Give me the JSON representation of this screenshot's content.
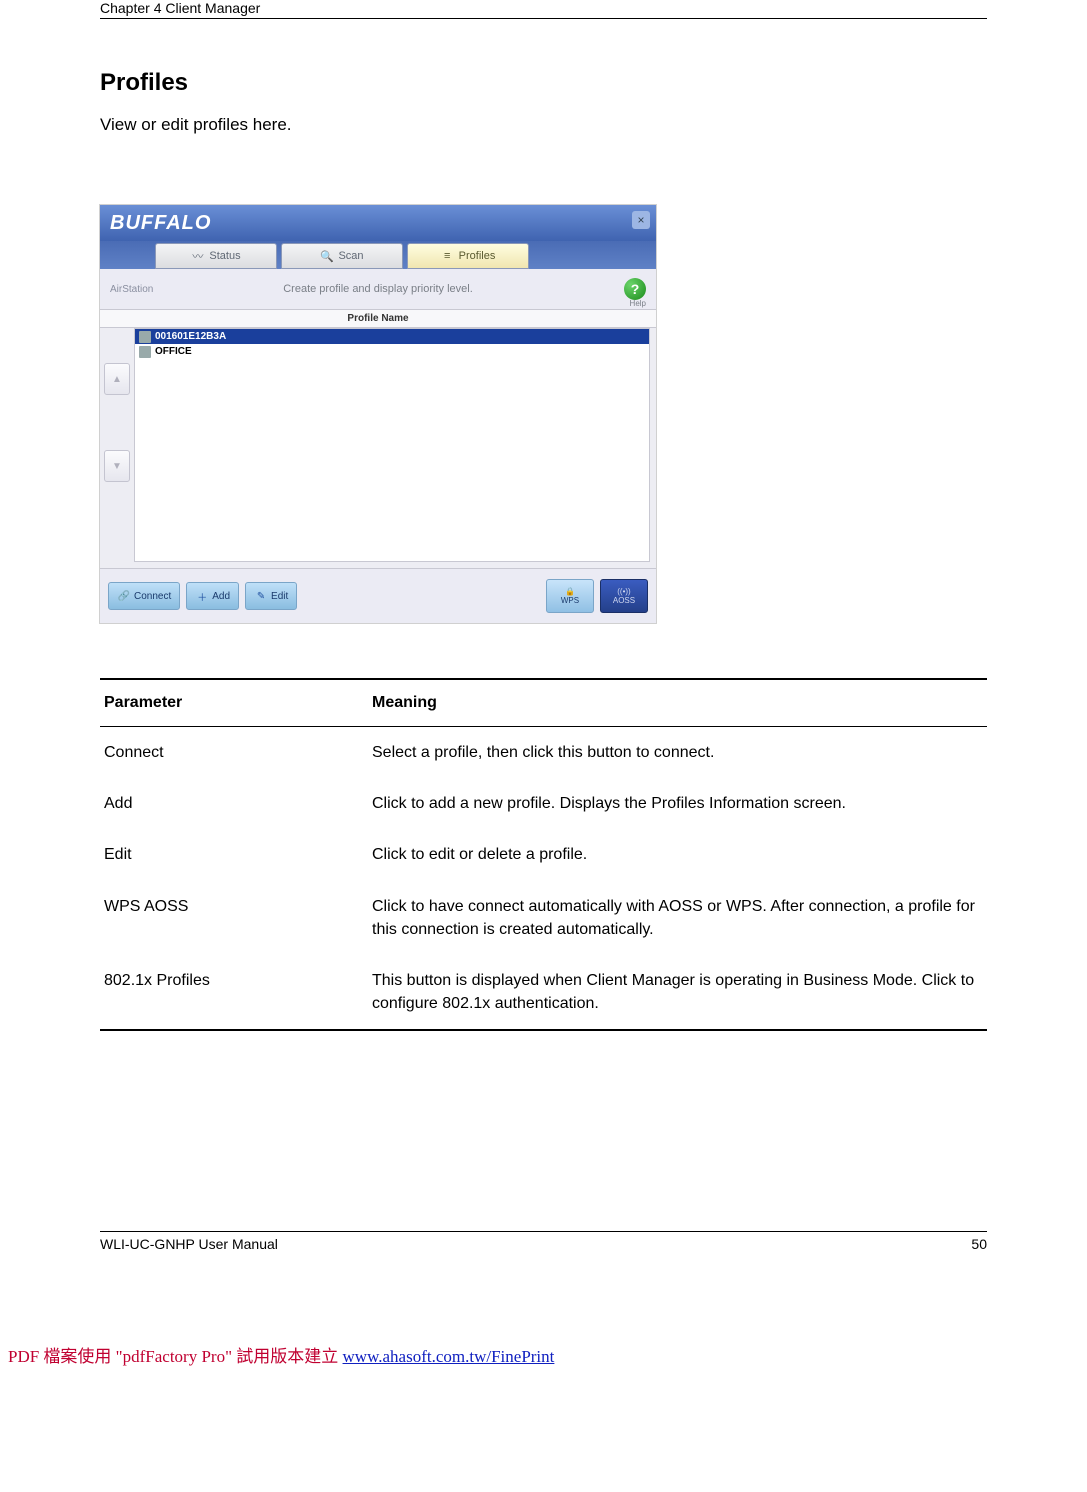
{
  "doc": {
    "chapter_header": "Chapter 4  Client Manager",
    "section_title": "Profiles",
    "section_intro": "View or edit profiles here.",
    "footer_manual": "WLI-UC-GNHP User Manual",
    "page_number": "50"
  },
  "app": {
    "logo": "BUFFALO",
    "close_glyph": "×",
    "tabs": {
      "status": "Status",
      "scan": "Scan",
      "profiles": "Profiles"
    },
    "brand_mini": "AirStation",
    "subheader_text": "Create profile and display priority level.",
    "help_glyph": "?",
    "help_label": "Help",
    "list_title": "Profile Name",
    "profiles_list": [
      "001601E12B3A",
      "OFFICE"
    ],
    "btn_connect": "Connect",
    "btn_add": "Add",
    "btn_edit": "Edit",
    "btn_wps": "WPS",
    "btn_aoss": "AOSS",
    "up_glyph": "▲",
    "down_glyph": "▼"
  },
  "table": {
    "header_param": "Parameter",
    "header_meaning": "Meaning",
    "rows": [
      {
        "param": "Connect",
        "meaning": "Select a profile, then click this button to connect."
      },
      {
        "param": "Add",
        "meaning": "Click to add a new profile.  Displays the Profiles Information screen."
      },
      {
        "param": "Edit",
        "meaning": "Click to edit or delete a profile."
      },
      {
        "param": "WPS  AOSS",
        "meaning": "Click to have connect automatically with AOSS or WPS.  After connection, a profile for this connection is created automatically."
      },
      {
        "param": "802.1x Profiles",
        "meaning": "This button is displayed when Client Manager is operating in Business Mode.  Click to configure 802.1x authentication."
      }
    ]
  },
  "watermark": {
    "prefix": "PDF 檔案使用 \"pdfFactory Pro\" 試用版本建立 ",
    "link_text": "www.ahasoft.com.tw/FinePrint"
  }
}
